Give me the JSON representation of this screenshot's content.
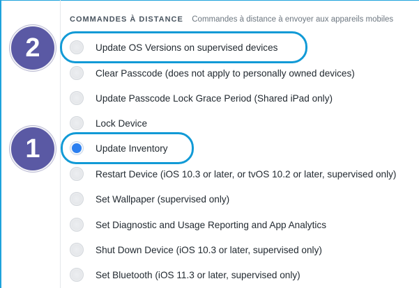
{
  "section": {
    "title": "COMMANDES À DISTANCE",
    "description": "Commandes à distance à envoyer aux appareils mobiles"
  },
  "options": [
    {
      "label": "Update OS Versions on supervised devices",
      "selected": false
    },
    {
      "label": "Clear Passcode (does not apply to personally owned devices)",
      "selected": false
    },
    {
      "label": "Update Passcode Lock Grace Period (Shared iPad only)",
      "selected": false
    },
    {
      "label": "Lock Device",
      "selected": false
    },
    {
      "label": "Update Inventory",
      "selected": true
    },
    {
      "label": "Restart Device (iOS 10.3 or later, or tvOS 10.2 or later, supervised only)",
      "selected": false
    },
    {
      "label": "Set Wallpaper (supervised only)",
      "selected": false
    },
    {
      "label": "Set Diagnostic and Usage Reporting and App Analytics",
      "selected": false
    },
    {
      "label": "Shut Down Device (iOS 10.3 or later, supervised only)",
      "selected": false
    },
    {
      "label": "Set Bluetooth (iOS 11.3 or later, supervised only)",
      "selected": false
    }
  ],
  "callouts": {
    "first": "1",
    "second": "2"
  },
  "colors": {
    "accent": "#119ad6",
    "radio_selected": "#2b7ff0",
    "callout_fill": "#5a59a4"
  }
}
